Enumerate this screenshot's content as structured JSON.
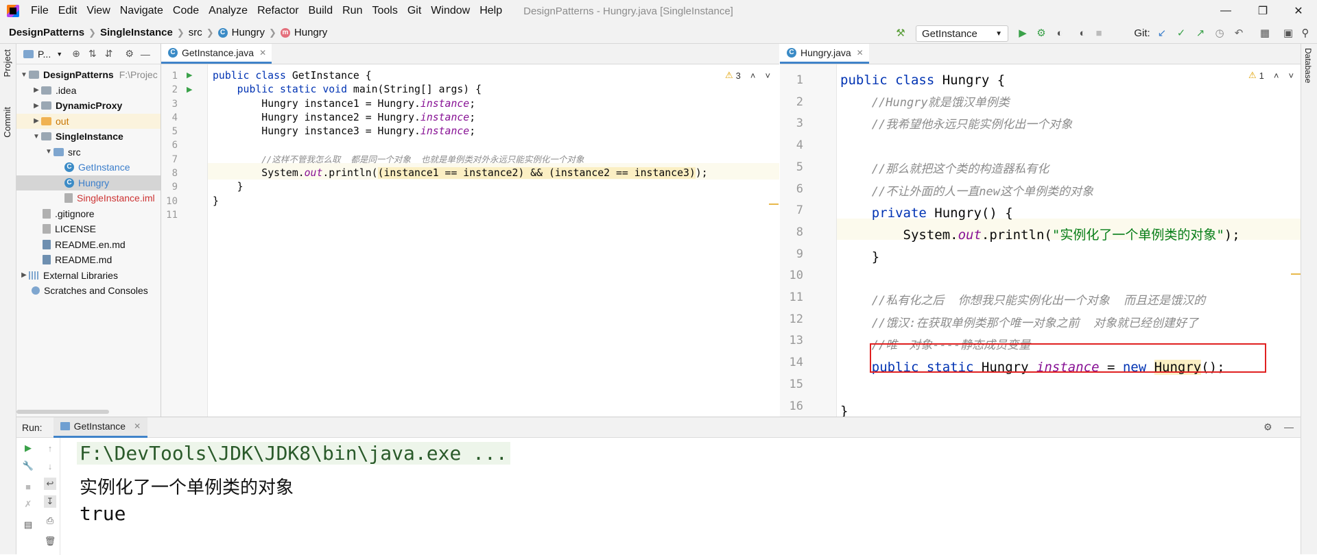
{
  "menubar": {
    "items": [
      "File",
      "Edit",
      "View",
      "Navigate",
      "Code",
      "Analyze",
      "Refactor",
      "Build",
      "Run",
      "Tools",
      "Git",
      "Window",
      "Help"
    ],
    "title": "DesignPatterns - Hungry.java [SingleInstance]"
  },
  "navbar": {
    "breadcrumbs": [
      "DesignPatterns",
      "SingleInstance",
      "src",
      "Hungry",
      "Hungry"
    ],
    "run_config": "GetInstance",
    "git_label": "Git:"
  },
  "left_stripe": {
    "project_tab": "Project",
    "commit_tab": "Commit"
  },
  "right_stripe": {
    "database_tab": "Database"
  },
  "project": {
    "header": "P...",
    "root_path": "F:\\Projec",
    "tree": [
      {
        "label": "DesignPatterns",
        "bold": true
      },
      {
        "label": ".idea"
      },
      {
        "label": "DynamicProxy",
        "bold": true
      },
      {
        "label": "out"
      },
      {
        "label": "SingleInstance",
        "bold": true
      },
      {
        "label": "src"
      },
      {
        "label": "GetInstance"
      },
      {
        "label": "Hungry"
      },
      {
        "label": "SingleInstance.iml"
      },
      {
        "label": ".gitignore"
      },
      {
        "label": "LICENSE"
      },
      {
        "label": "README.en.md"
      },
      {
        "label": "README.md"
      },
      {
        "label": "External Libraries"
      },
      {
        "label": "Scratches and Consoles"
      }
    ]
  },
  "editor_left": {
    "tab": "GetInstance.java",
    "warnings": "3",
    "line_numbers": [
      "1",
      "2",
      "3",
      "4",
      "5",
      "6",
      "7",
      "8",
      "9",
      "10",
      "11"
    ],
    "code": {
      "l1_kw": "public class ",
      "l1_rest": "GetInstance {",
      "l2_kw": "public static void ",
      "l2_rest": "main(String[] args) {",
      "l3_a": "Hungry instance1 = Hungry.",
      "l3_f": "instance",
      "l3_e": ";",
      "l4_a": "Hungry instance2 = Hungry.",
      "l4_f": "instance",
      "l4_e": ";",
      "l5_a": "Hungry instance3 = Hungry.",
      "l5_f": "instance",
      "l5_e": ";",
      "l7_cmt": "//这样不管我怎么取  都是同一个对象  也就是单例类对外永远只能实例化一个对象",
      "l8_a": "System.",
      "l8_f": "out",
      "l8_b": ".println(",
      "l8_c": "(instance1 == instance2) && (instance2 == instance3)",
      "l8_e": ");",
      "l9": "}",
      "l10": "}"
    }
  },
  "editor_right": {
    "tab": "Hungry.java",
    "warnings": "1",
    "line_numbers": [
      "1",
      "2",
      "3",
      "4",
      "5",
      "6",
      "7",
      "8",
      "9",
      "10",
      "11",
      "12",
      "13",
      "14",
      "15",
      "16"
    ],
    "code": {
      "l1_kw": "public class ",
      "l1_rest": "Hungry {",
      "l2": "//Hungry就是饿汉单例类",
      "l3": "//我希望他永远只能实例化出一个对象",
      "l5": "//那么就把这个类的构造器私有化",
      "l6": "//不让外面的人一直new这个单例类的对象",
      "l7_kw": "private ",
      "l7_rest": "Hungry() {",
      "l8_a": "System.",
      "l8_f": "out",
      "l8_b": ".println(",
      "l8_s": "\"实例化了一个单例类的对象\"",
      "l8_e": ");",
      "l9": "}",
      "l11": "//私有化之后  你想我只能实例化出一个对象  而且还是饿汉的",
      "l12": "//饿汉:在获取单例类那个唯一对象之前  对象就已经创建好了",
      "l13": "//唯一对象----静态成员变量",
      "l14_kw": "public static ",
      "l14_a": "Hungry ",
      "l14_f": "instance",
      "l14_b": " = ",
      "l14_kw2": "new ",
      "l14_c": "Hungry",
      "l14_e": "();",
      "l16": "}"
    }
  },
  "run": {
    "label": "Run:",
    "tab": "GetInstance",
    "output": [
      "F:\\DevTools\\JDK\\JDK8\\bin\\java.exe ...",
      "实例化了一个单例类的对象",
      "true"
    ]
  }
}
